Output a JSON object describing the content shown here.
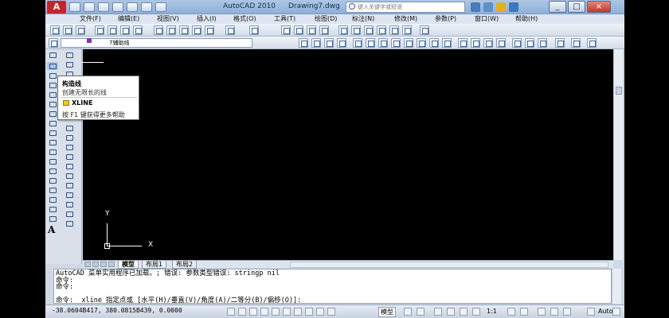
{
  "titlebar": {
    "app_name": "AutoCAD 2010",
    "document_name": "Drawing7.dwg",
    "search_placeholder": "键入关键字或短语"
  },
  "menu": [
    "文件(F)",
    "编辑(E)",
    "视图(V)",
    "插入(I)",
    "格式(O)",
    "工具(T)",
    "绘图(D)",
    "标注(N)",
    "修改(M)",
    "参数(P)",
    "窗口(W)",
    "帮助(H)"
  ],
  "layer_toolbar": {
    "current_layer": "7辅助线"
  },
  "tooltip": {
    "title": "构造线",
    "description": "创建无限长的线",
    "command": "XLINE",
    "help": "按 F1 键获得更多帮助"
  },
  "draw_tools": {
    "text_tool": "A"
  },
  "tabs": [
    "模型",
    "布局1",
    "布局2"
  ],
  "command_lines": [
    "AutoCAD 菜单实用程序已加载。; 错误: 参数类型错误: stringp nil",
    "命令:",
    "命令:",
    "",
    "命令:  xline 指定点或 [水平(H)/垂直(V)/角度(A)/二等分(B)/偏移(O)]:"
  ],
  "status": {
    "coordinates": "-38.0604B417, 380.0815B439, 0.0000",
    "model_button": "模型",
    "annotation_scale": "1:1",
    "workspace": "Auto"
  },
  "ucs": {
    "x_label": "X",
    "y_label": "Y"
  },
  "colors": {
    "canvas": "#000000",
    "app_logo": "#c8232c",
    "title_gradient_top": "#aec6e4"
  }
}
